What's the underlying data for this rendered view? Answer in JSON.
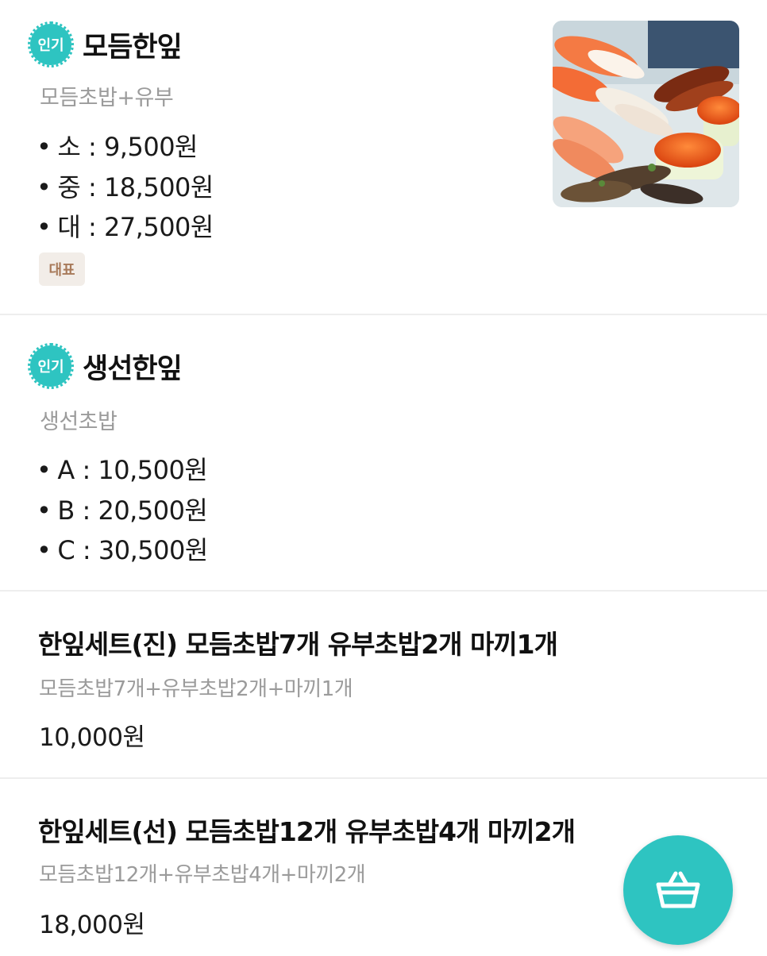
{
  "menu": {
    "items": [
      {
        "badge": "인기",
        "name": "모듬한잎",
        "description": "모듬초밥+유부",
        "prices": [
          "소 : 9,500원",
          "중 : 18,500원",
          "대 : 27,500원"
        ],
        "tag": "대표",
        "image_icon": "sushi-photo"
      },
      {
        "badge": "인기",
        "name": "생선한잎",
        "description": "생선초밥",
        "prices": [
          "A : 10,500원",
          "B : 20,500원",
          "C : 30,500원"
        ]
      },
      {
        "name": "한잎세트(진) 모듬초밥7개 유부초밥2개 마끼1개",
        "description": "모듬초밥7개+유부초밥2개+마끼1개",
        "price": "10,000원"
      },
      {
        "name": "한잎세트(선) 모듬초밥12개 유부초밥4개 마끼2개",
        "description": "모듬초밥12개+유부초밥4개+마끼2개",
        "price": "18,000원"
      }
    ],
    "bullet": "•"
  },
  "cart": {
    "icon": "basket-icon"
  },
  "colors": {
    "accent": "#2ec4c1",
    "tag_bg": "#f2ede8",
    "tag_text": "#a87a5a",
    "muted_text": "#9b9b9b"
  }
}
